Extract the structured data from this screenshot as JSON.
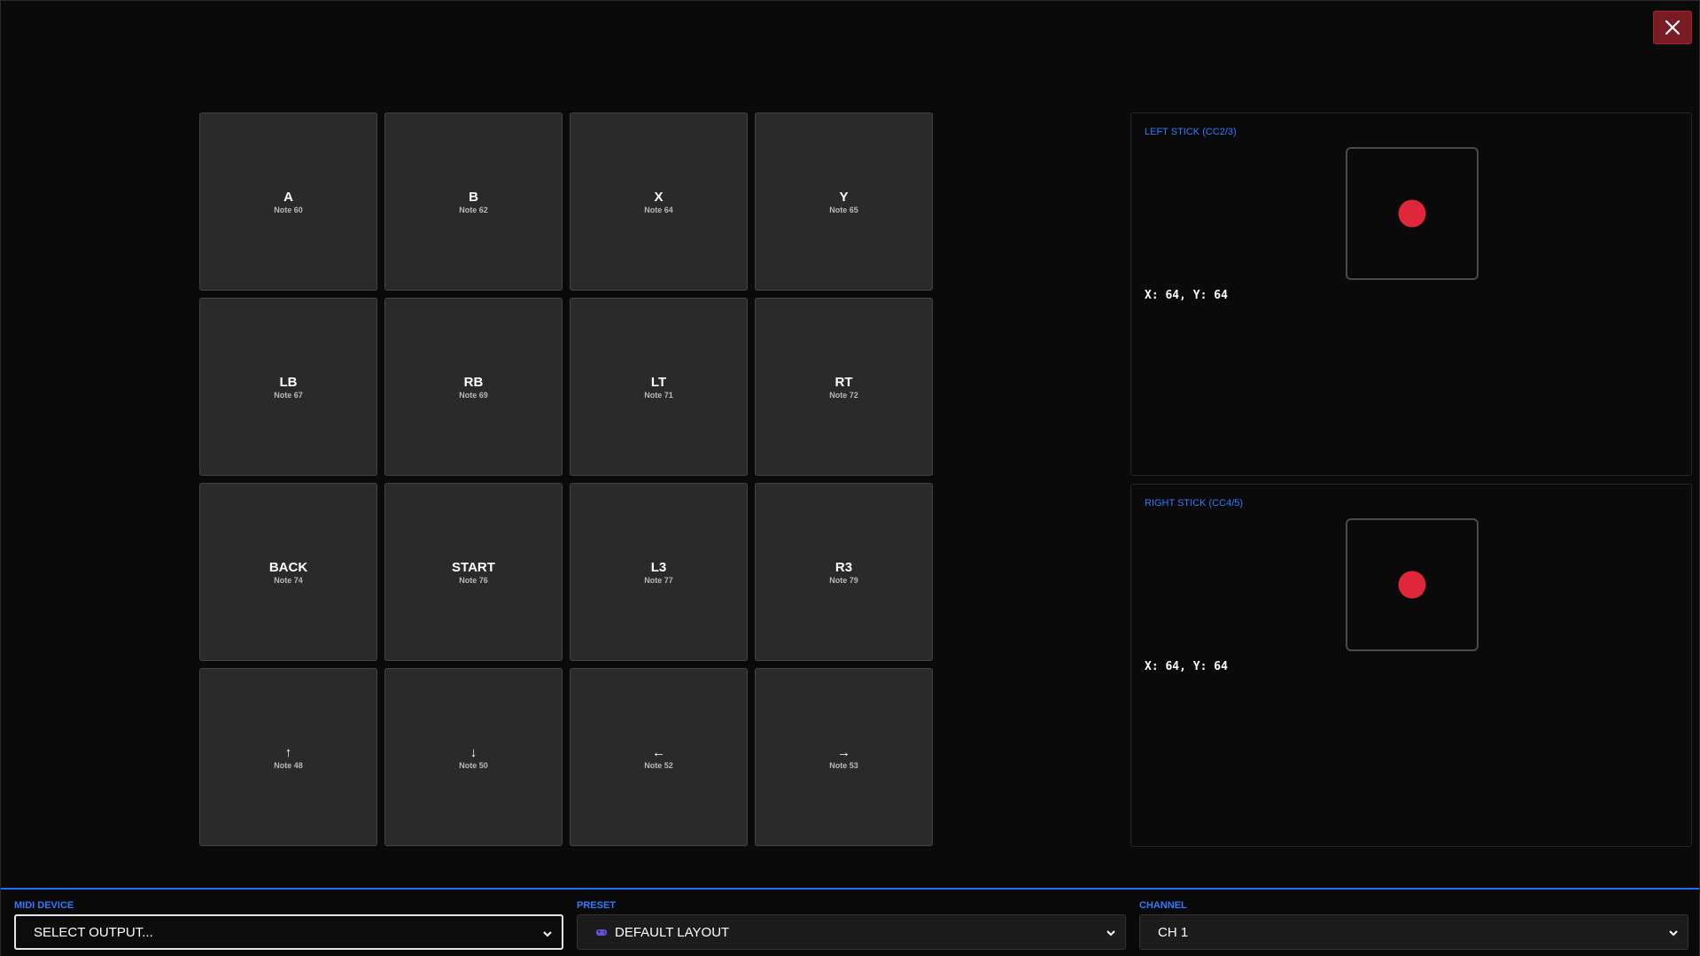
{
  "close_button": {
    "icon": "close-icon",
    "color": "#7a1a22"
  },
  "pads": [
    {
      "label": "A",
      "note": "Note 60"
    },
    {
      "label": "B",
      "note": "Note 62"
    },
    {
      "label": "X",
      "note": "Note 64"
    },
    {
      "label": "Y",
      "note": "Note 65"
    },
    {
      "label": "LB",
      "note": "Note 67"
    },
    {
      "label": "RB",
      "note": "Note 69"
    },
    {
      "label": "LT",
      "note": "Note 71"
    },
    {
      "label": "RT",
      "note": "Note 72"
    },
    {
      "label": "BACK",
      "note": "Note 74"
    },
    {
      "label": "START",
      "note": "Note 76"
    },
    {
      "label": "L3",
      "note": "Note 77"
    },
    {
      "label": "R3",
      "note": "Note 79"
    },
    {
      "label": "↑",
      "note": "Note 48"
    },
    {
      "label": "↓",
      "note": "Note 50"
    },
    {
      "label": "←",
      "note": "Note 52"
    },
    {
      "label": "→",
      "note": "Note 53"
    }
  ],
  "sticks": {
    "left": {
      "title": "LEFT STICK (CC2/3)",
      "readout": "X: 64, Y: 64",
      "x": 64,
      "y": 64
    },
    "right": {
      "title": "RIGHT STICK (CC4/5)",
      "readout": "X: 64, Y: 64",
      "x": 64,
      "y": 64
    }
  },
  "bottom_bar": {
    "midi_device": {
      "label": "MIDI DEVICE",
      "value": "SELECT OUTPUT..."
    },
    "preset": {
      "label": "PRESET",
      "value": "DEFAULT LAYOUT",
      "icon": "gamepad-icon"
    },
    "channel": {
      "label": "CHANNEL",
      "value": "CH 1"
    }
  },
  "colors": {
    "accent": "#2f7bff",
    "knob": "#e0263a",
    "pad_bg": "#2a2a2a",
    "background": "#0a0a0a"
  }
}
